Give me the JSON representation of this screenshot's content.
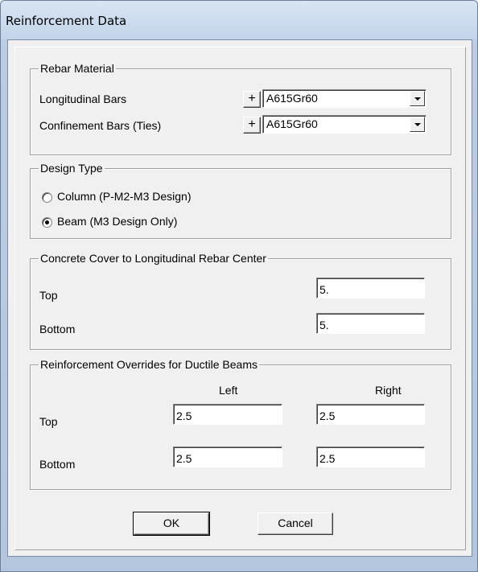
{
  "window": {
    "title": "Reinforcement Data"
  },
  "rebar_material": {
    "legend": "Rebar Material",
    "longitudinal_label": "Longitudinal Bars",
    "longitudinal_value": "A615Gr60",
    "confinement_label": "Confinement Bars  (Ties)",
    "confinement_value": "A615Gr60",
    "plus_label": "+"
  },
  "design_type": {
    "legend": "Design Type",
    "column_label": "Column  (P-M2-M3 Design)",
    "beam_label": "Beam  (M3 Design Only)",
    "selected": "beam"
  },
  "concrete_cover": {
    "legend": "Concrete Cover to Longitudinal Rebar Center",
    "top_label": "Top",
    "top_value": "5.",
    "bottom_label": "Bottom",
    "bottom_value": "5."
  },
  "overrides": {
    "legend": "Reinforcement Overrides for Ductile Beams",
    "left_header": "Left",
    "right_header": "Right",
    "top_label": "Top",
    "bottom_label": "Bottom",
    "top_left": "2.5",
    "top_right": "2.5",
    "bottom_left": "2.5",
    "bottom_right": "2.5"
  },
  "buttons": {
    "ok": "OK",
    "cancel": "Cancel"
  }
}
